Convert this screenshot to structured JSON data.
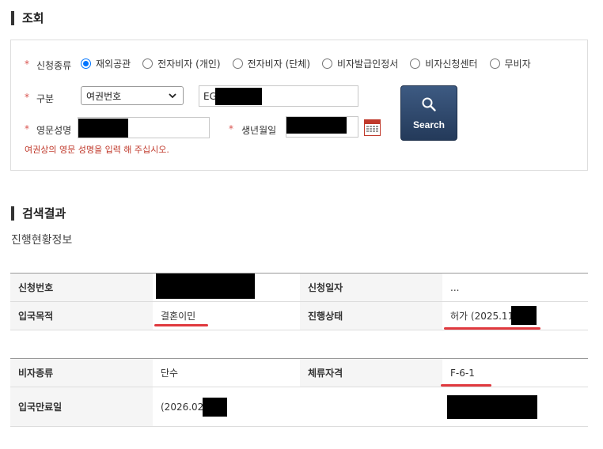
{
  "inquiry": {
    "title": "조회",
    "labels": {
      "type": "신청종류",
      "category": "구분",
      "eng_name": "영문성명",
      "birth": "생년월일"
    },
    "required_mark": "*",
    "radios": [
      {
        "label": "재외공관",
        "selected": true
      },
      {
        "label": "전자비자 (개인)",
        "selected": false
      },
      {
        "label": "전자비자 (단체)",
        "selected": false
      },
      {
        "label": "비자발급인정서",
        "selected": false
      },
      {
        "label": "비자신청센터",
        "selected": false
      },
      {
        "label": "무비자",
        "selected": false
      }
    ],
    "category_select": {
      "value": "여권번호"
    },
    "passport_input": {
      "value": "EG"
    },
    "helper_text": "여권상의 영문 성명을 입력 해 주십시오.",
    "search_button": "Search",
    "colors": {
      "required": "#d9534f",
      "helper": "#c0392b",
      "button": "#2e4a6e",
      "radio": "#0075ff"
    }
  },
  "results": {
    "title": "검색결과",
    "subtitle": "진행현황정보",
    "table1": [
      {
        "label1": "신청번호",
        "value1": "",
        "label2": "신청일자",
        "value2": "..."
      },
      {
        "label1": "입국목적",
        "value1": "결혼이민",
        "label2": "진행상태",
        "value2": "허가 (2025.11"
      }
    ],
    "table2": [
      {
        "label1": "비자종류",
        "value1": "단수",
        "label2": "체류자격",
        "value2": "F-6-1"
      },
      {
        "label1": "입국만료일",
        "value1": "(2026.02",
        "label2": "",
        "value2": ""
      }
    ],
    "highlight_color": "#e0393e"
  }
}
